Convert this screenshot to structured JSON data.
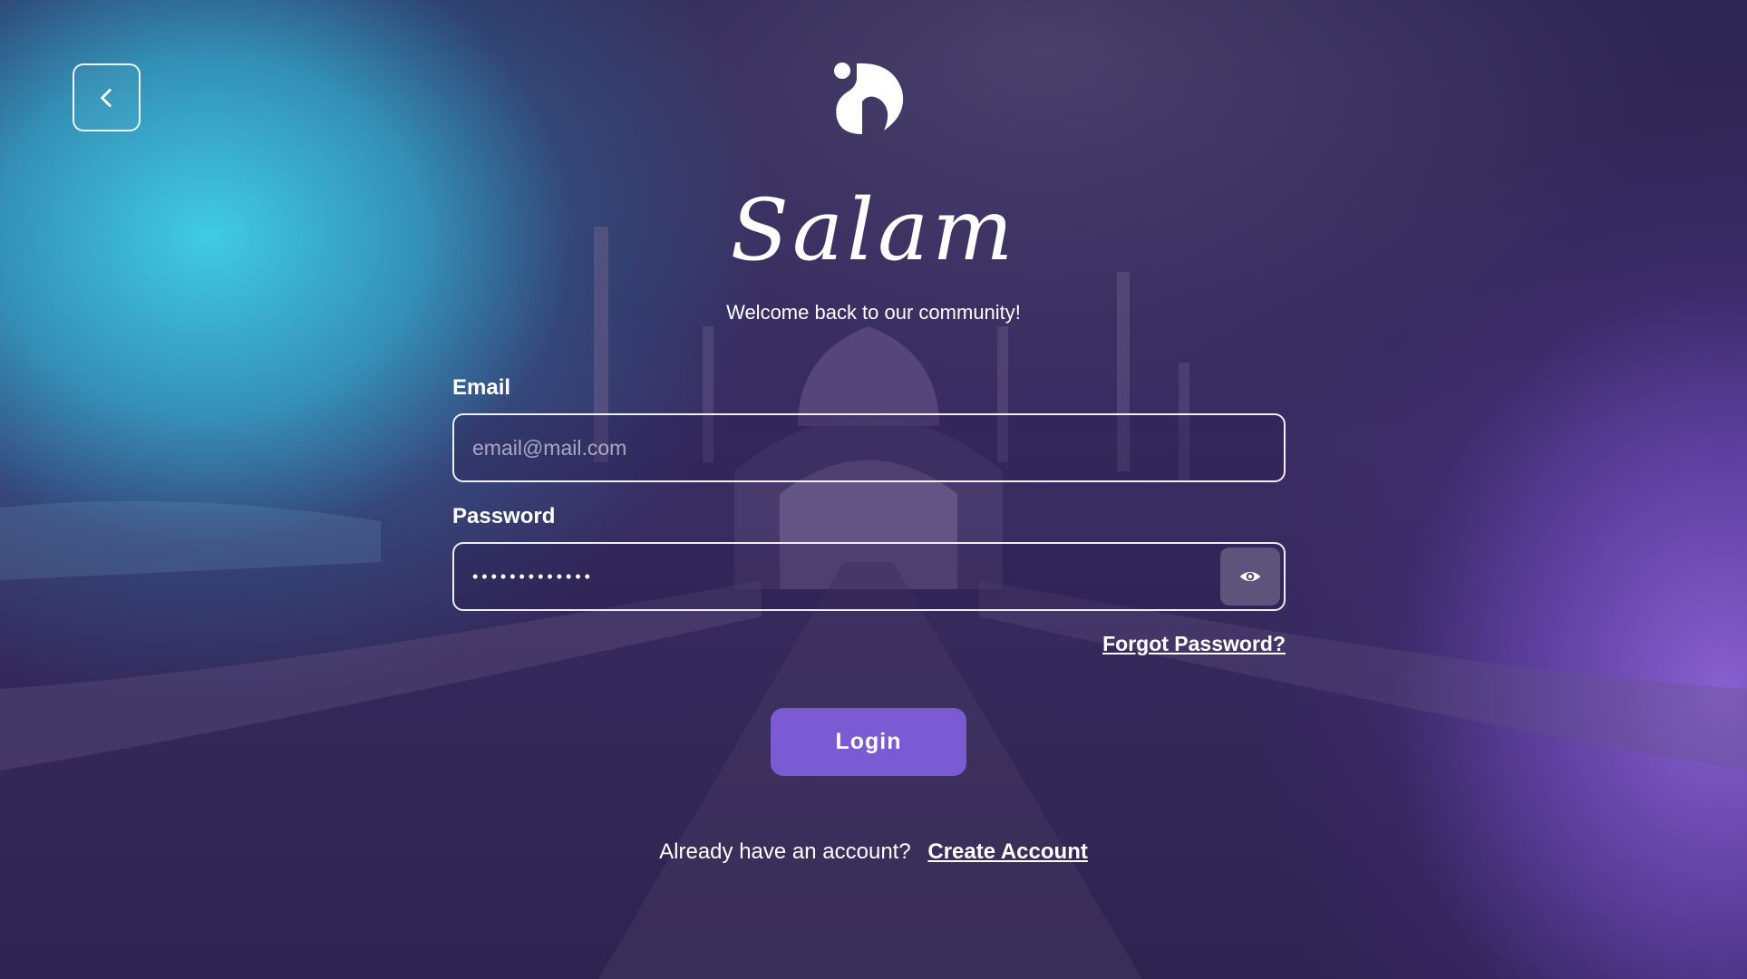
{
  "nav": {
    "back_icon": "chevron-left-icon"
  },
  "brand": {
    "logo_icon": "salam-s-logo-icon",
    "title": "Salam",
    "subtitle": "Welcome back to our community!"
  },
  "form": {
    "email": {
      "label": "Email",
      "placeholder": "email@mail.com",
      "value": ""
    },
    "password": {
      "label": "Password",
      "value": "•••••••••••••",
      "toggle_icon": "eye-icon"
    },
    "forgot_label": "Forgot Password?",
    "login_label": "Login"
  },
  "signup": {
    "prompt": "Already have an account?",
    "link_label": "Create Account"
  },
  "colors": {
    "accent": "#7a5bd3",
    "background": "#2e2350",
    "cyan_glow": "#40d4ec",
    "purple_glow": "#8c62d6"
  }
}
